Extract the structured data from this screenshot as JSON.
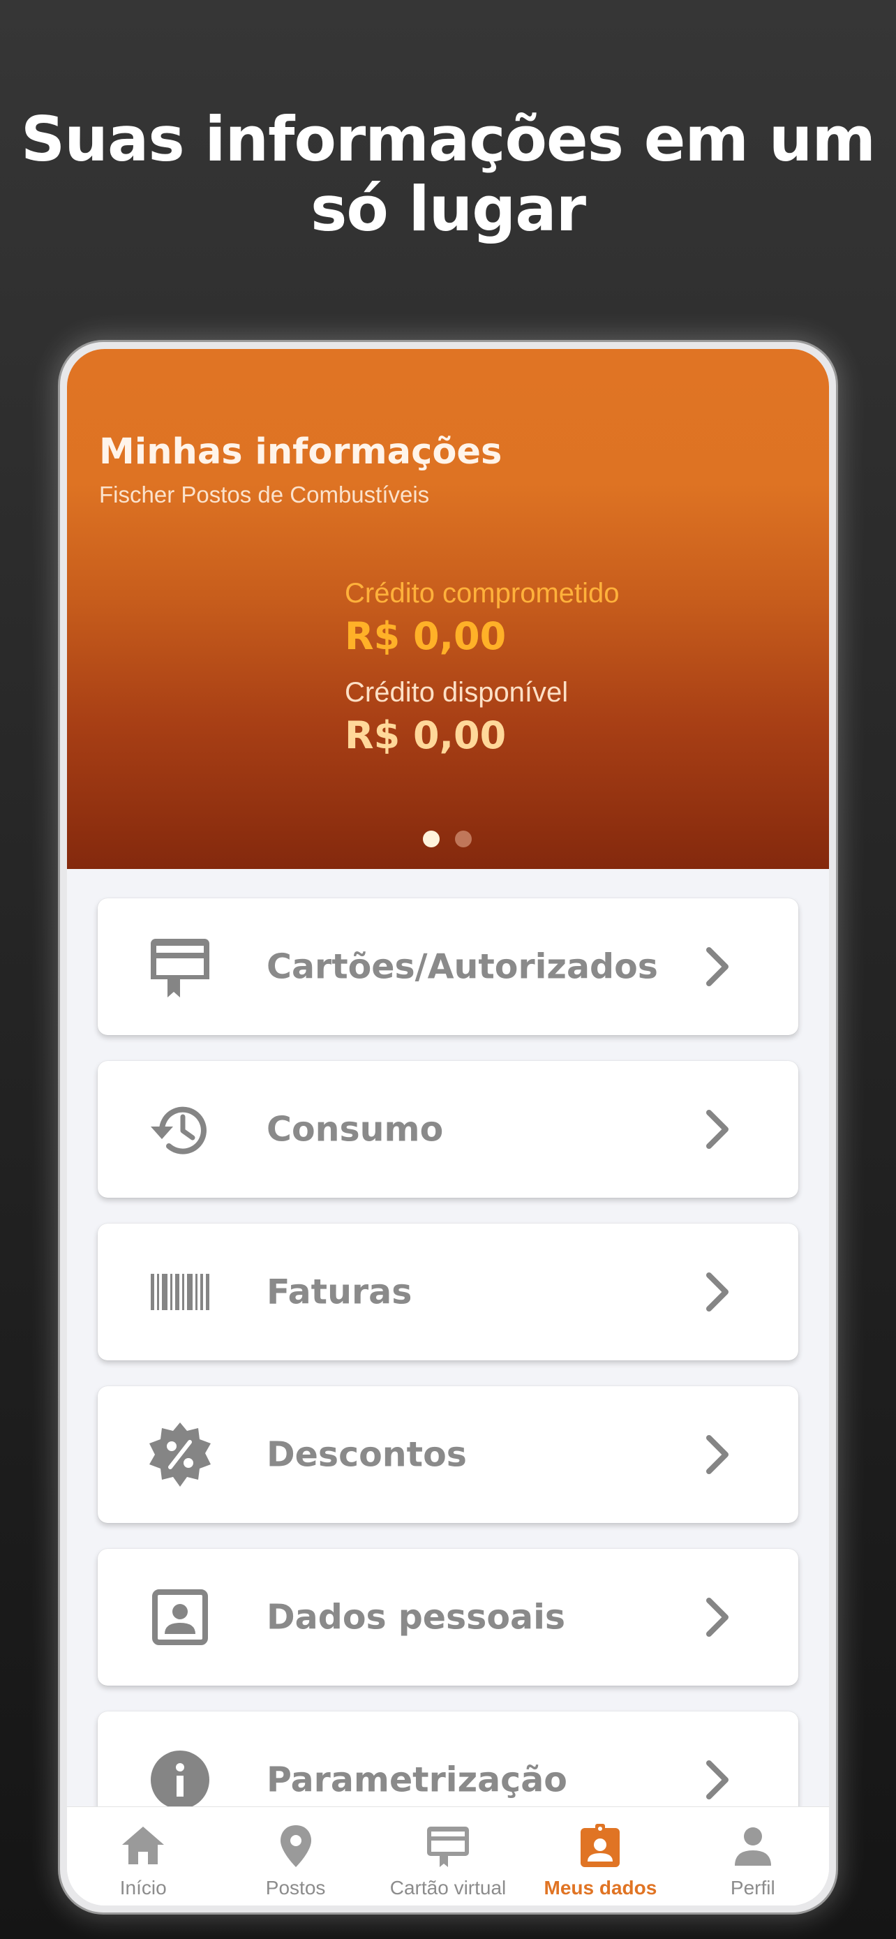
{
  "headline": {
    "line1": "Suas informações em um",
    "line2": "só lugar"
  },
  "banner": {
    "title": "Minhas informações",
    "subtitle": "Fischer Postos de Combustíveis",
    "committed_label": "Crédito comprometido",
    "committed_value": "R$ 0,00",
    "available_label": "Crédito disponível",
    "available_value": "R$ 0,00",
    "pager": {
      "count": 2,
      "active": 1
    }
  },
  "menu": [
    {
      "label": "Cartões/Autorizados",
      "icon": "card-ribbon-icon"
    },
    {
      "label": "Consumo",
      "icon": "history-icon"
    },
    {
      "label": "Faturas",
      "icon": "barcode-icon"
    },
    {
      "label": "Descontos",
      "icon": "discount-badge-icon"
    },
    {
      "label": "Dados pessoais",
      "icon": "contact-portrait-icon"
    },
    {
      "label": "Parametrização",
      "icon": "info-icon"
    }
  ],
  "nav": [
    {
      "label": "Início",
      "icon": "home-icon"
    },
    {
      "label": "Postos",
      "icon": "map-pin-icon"
    },
    {
      "label": "Cartão virtual",
      "icon": "card-icon"
    },
    {
      "label": "Meus dados",
      "icon": "badge-id-icon",
      "active": true
    },
    {
      "label": "Perfil",
      "icon": "person-icon"
    }
  ],
  "colors": {
    "accent": "#e07424",
    "icon_gray": "#858585",
    "credit_value": "#ffb128"
  }
}
